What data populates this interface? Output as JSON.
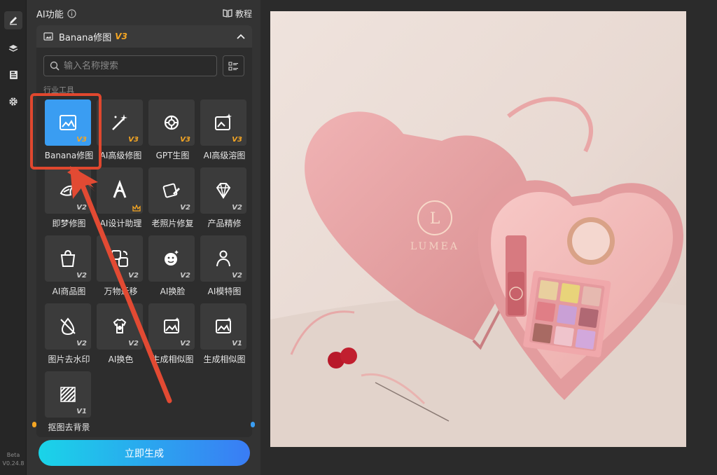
{
  "panel": {
    "title": "AI功能",
    "tutorial_label": "教程"
  },
  "feature": {
    "name": "Banana修图",
    "version": "V3"
  },
  "search": {
    "placeholder": "输入名称搜索"
  },
  "section_label": "行业工具",
  "tools": [
    {
      "label": "Banana修图",
      "badge": "V3",
      "icon": "image-edit-icon",
      "selected": true
    },
    {
      "label": "AI高级修图",
      "badge": "V3",
      "icon": "magic-wand-icon"
    },
    {
      "label": "GPT生图",
      "badge": "V3",
      "icon": "openai-icon"
    },
    {
      "label": "AI高级溶图",
      "badge": "V3",
      "icon": "image-sparkle-icon"
    },
    {
      "label": "即梦修图",
      "badge": "V2",
      "icon": "jimeng-icon"
    },
    {
      "label": "AI设计助理",
      "badge": "",
      "icon": "design-assistant-icon",
      "crown": true
    },
    {
      "label": "老照片修复",
      "badge": "V2",
      "icon": "photo-repair-icon"
    },
    {
      "label": "产品精修",
      "badge": "V2",
      "icon": "diamond-icon"
    },
    {
      "label": "AI商品图",
      "badge": "V2",
      "icon": "shopping-bag-icon"
    },
    {
      "label": "万物迁移",
      "badge": "V2",
      "icon": "migrate-icon"
    },
    {
      "label": "AI换脸",
      "badge": "V2",
      "icon": "face-swap-icon"
    },
    {
      "label": "AI模特图",
      "badge": "V2",
      "icon": "model-icon"
    },
    {
      "label": "图片去水印",
      "badge": "V2",
      "icon": "watermark-remove-icon"
    },
    {
      "label": "AI换色",
      "badge": "V2",
      "icon": "recolor-icon"
    },
    {
      "label": "生成相似图",
      "badge": "V2",
      "icon": "similar-image-icon"
    },
    {
      "label": "生成相似图",
      "badge": "V1",
      "icon": "similar-image-icon"
    },
    {
      "label": "抠图去背景",
      "badge": "V1",
      "icon": "remove-bg-icon"
    }
  ],
  "generate_label": "立即生成",
  "version_info": {
    "beta": "Beta",
    "version": "V0.24.8"
  },
  "product": {
    "brand": "LUMEA",
    "logo_letter": "L"
  },
  "colors": {
    "accent": "#3a9df2",
    "highlight": "#e0472e",
    "badge_v3": "#f5a623"
  }
}
